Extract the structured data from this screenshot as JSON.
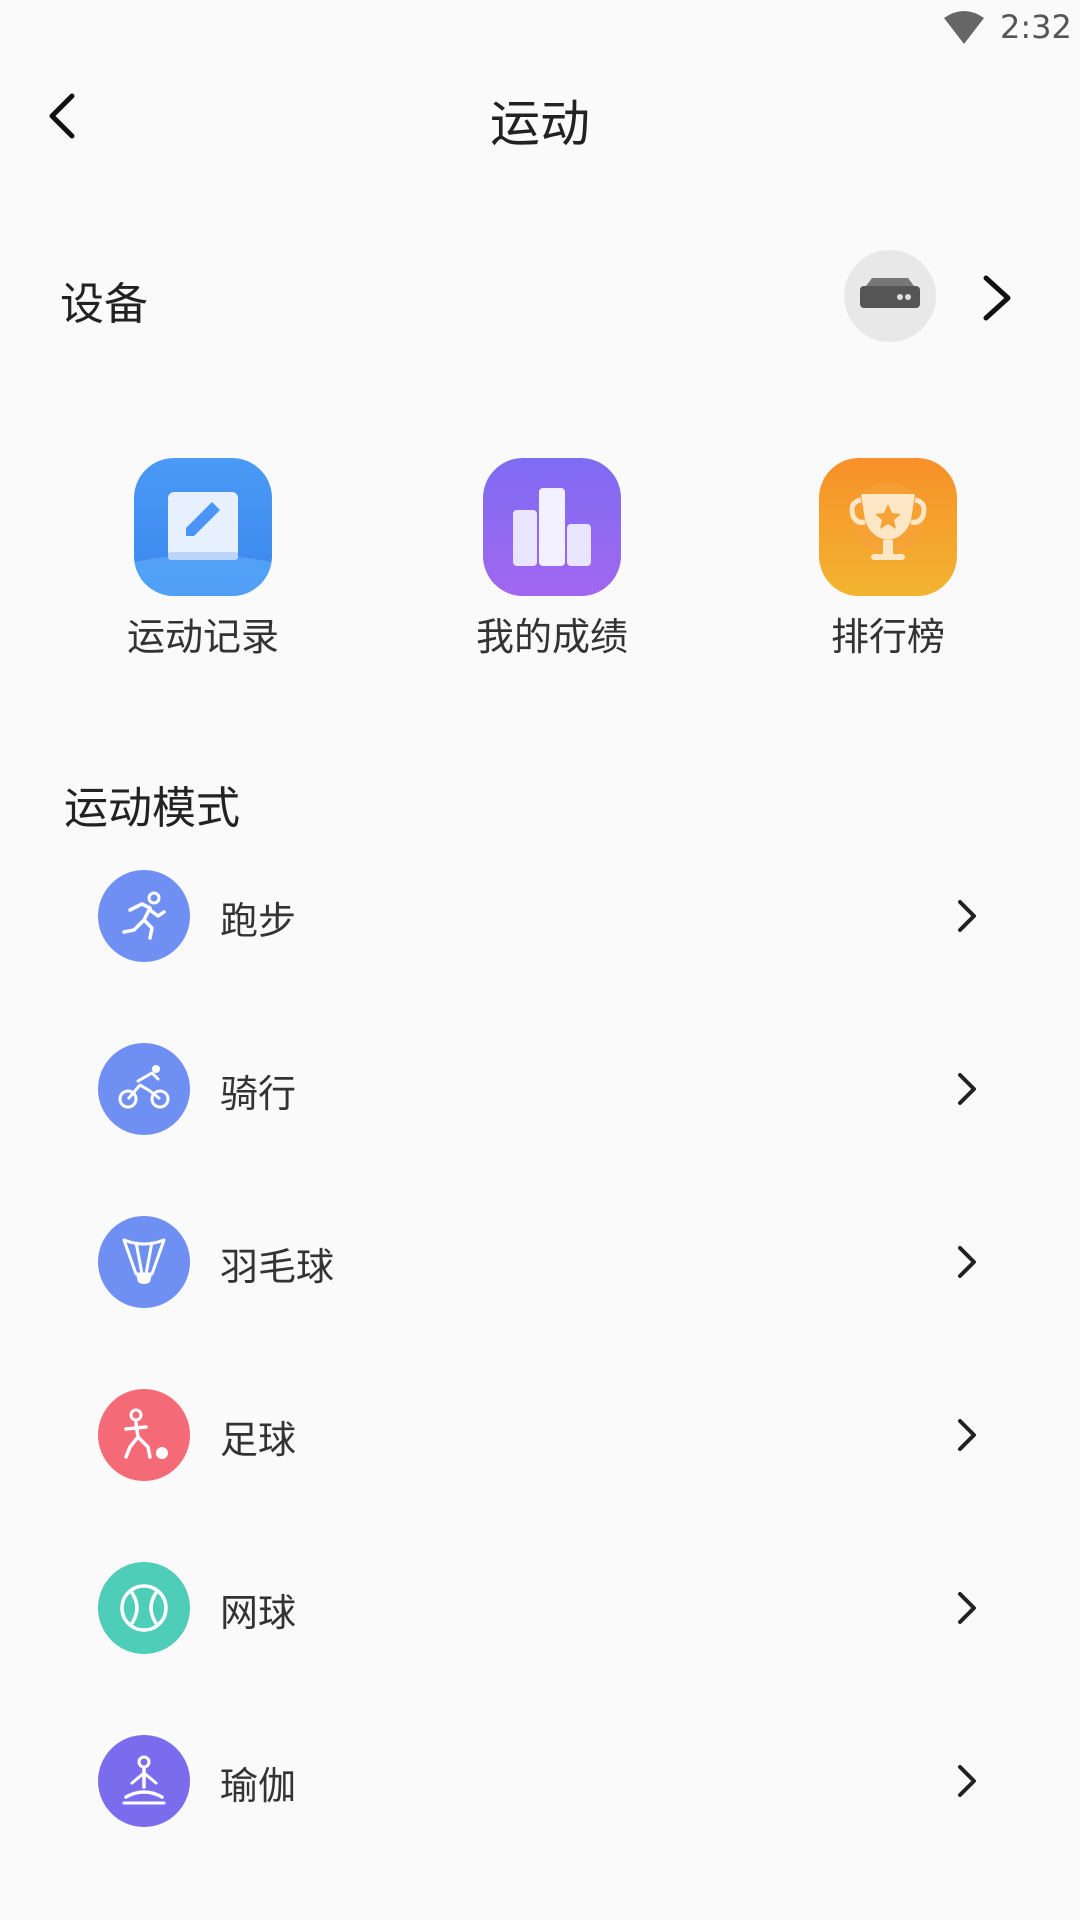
{
  "status_bar": {
    "time": "2:32",
    "wifi_icon": "wifi-icon"
  },
  "header": {
    "title": "运动",
    "back_icon": "back-arrow-icon"
  },
  "device": {
    "label": "设备",
    "avatar_icon": "device-icon",
    "chevron_icon": "chevron-right-icon"
  },
  "quick_actions": [
    {
      "label": "运动记录",
      "icon": "notebook-icon",
      "color": "#4a95f5"
    },
    {
      "label": "我的成绩",
      "icon": "bar-chart-icon",
      "color": "#8a63ef"
    },
    {
      "label": "排行榜",
      "icon": "trophy-icon",
      "color": "#f39a2c"
    }
  ],
  "section": {
    "title": "运动模式"
  },
  "sports": [
    {
      "label": "跑步",
      "icon": "running-icon",
      "color": "#6f8ff3"
    },
    {
      "label": "骑行",
      "icon": "cycling-icon",
      "color": "#6f8ff3"
    },
    {
      "label": "羽毛球",
      "icon": "badminton-icon",
      "color": "#6f8ff3"
    },
    {
      "label": "足球",
      "icon": "soccer-icon",
      "color": "#f46a77"
    },
    {
      "label": "网球",
      "icon": "tennis-icon",
      "color": "#4ecdb8"
    },
    {
      "label": "瑜伽",
      "icon": "yoga-icon",
      "color": "#7b6cee"
    }
  ]
}
